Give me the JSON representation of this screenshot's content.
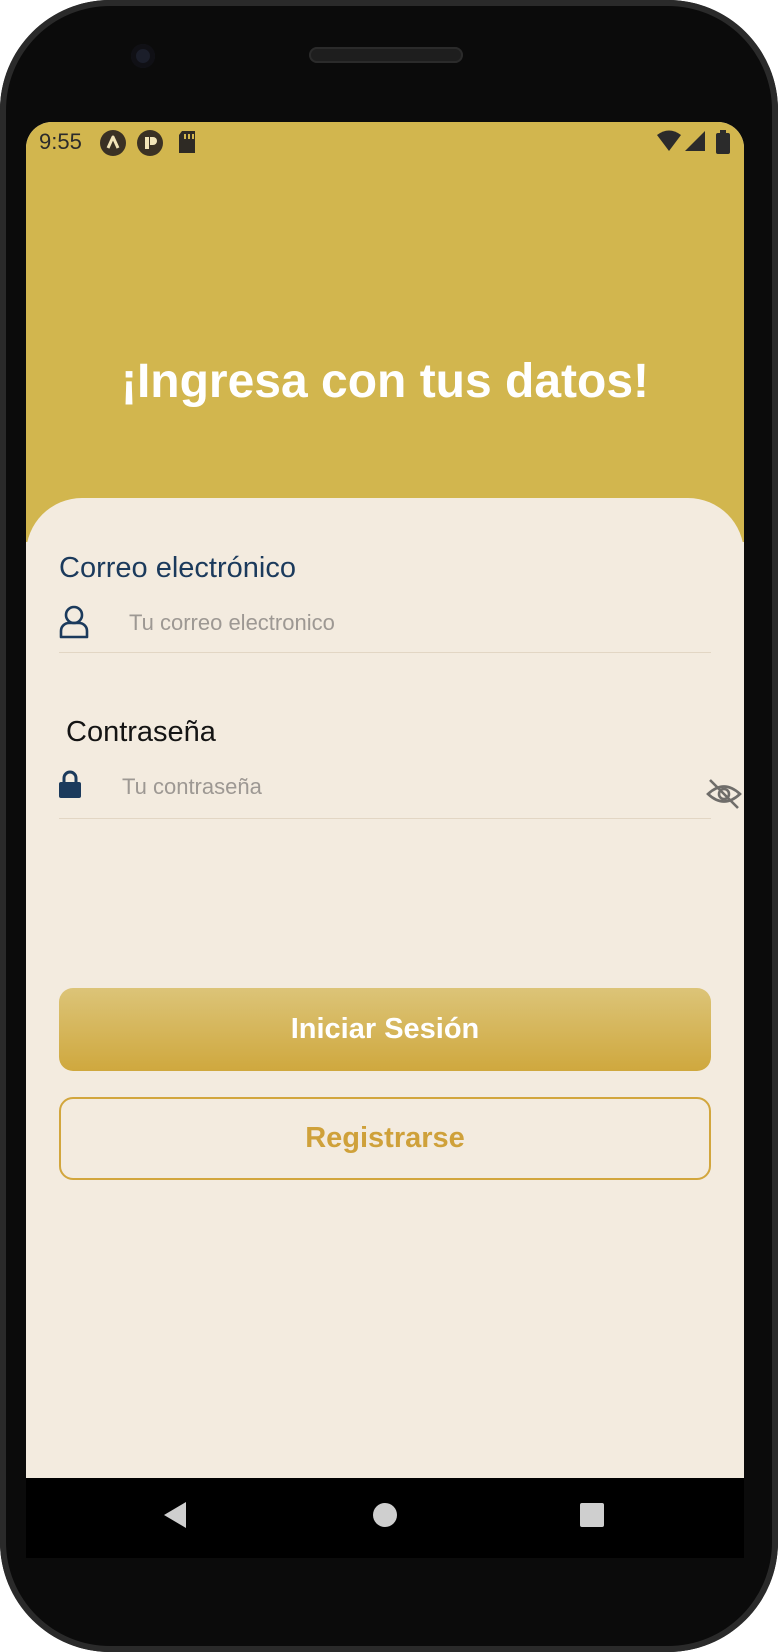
{
  "status_bar": {
    "time": "9:55",
    "left_icons": [
      "launcher-a-icon",
      "app-p-icon",
      "sd-card-icon"
    ],
    "right_icons": [
      "wifi-icon",
      "cell-signal-icon",
      "battery-icon"
    ]
  },
  "header": {
    "title": "¡Ingresa con tus datos!",
    "background": "#d2b64e"
  },
  "form": {
    "email_label": "Correo electrónico",
    "email_placeholder": "Tu correo electronico",
    "password_label": "Contraseña",
    "password_placeholder": "Tu contraseña",
    "icons": {
      "email": "user-icon",
      "password": "lock-icon",
      "toggle": "eye-off-icon"
    }
  },
  "actions": {
    "login_label": "Iniciar Sesión",
    "register_label": "Registrarse",
    "accent": "#cfa13a"
  },
  "navigation": {
    "buttons": [
      "back-icon",
      "home-icon",
      "recents-icon"
    ]
  }
}
